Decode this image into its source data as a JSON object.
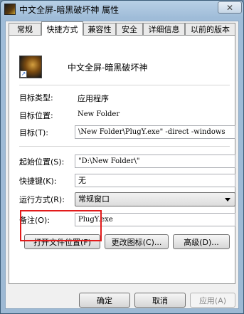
{
  "window": {
    "title": "中文全屏-暗黑破坏神 属性",
    "close_glyph": "✕"
  },
  "tabs": [
    {
      "label": "常规"
    },
    {
      "label": "快捷方式"
    },
    {
      "label": "兼容性"
    },
    {
      "label": "安全"
    },
    {
      "label": "详细信息"
    },
    {
      "label": "以前的版本"
    }
  ],
  "shortcut": {
    "name": "中文全屏-暗黑破坏神",
    "icon": "diablo-app-icon",
    "fields": {
      "target_type_label": "目标类型:",
      "target_type_value": "应用程序",
      "target_location_label": "目标位置:",
      "target_location_value": "New Folder",
      "target_label": "目标(T):",
      "target_value": "\\New Folder\\PlugY.exe\" -direct -windows",
      "start_in_label": "起始位置(S):",
      "start_in_value": "\"D:\\New Folder\\\"",
      "hotkey_label": "快捷键(K):",
      "hotkey_value": "无",
      "run_label": "运行方式(R):",
      "run_value": "常规窗口",
      "comment_label": "备注(O):",
      "comment_value": "PlugY.exe"
    },
    "buttons": {
      "open_location": "打开文件位置(F)",
      "change_icon": "更改图标(C)...",
      "advanced": "高级(D)..."
    }
  },
  "footer": {
    "ok": "确定",
    "cancel": "取消",
    "apply": "应用(A)"
  }
}
